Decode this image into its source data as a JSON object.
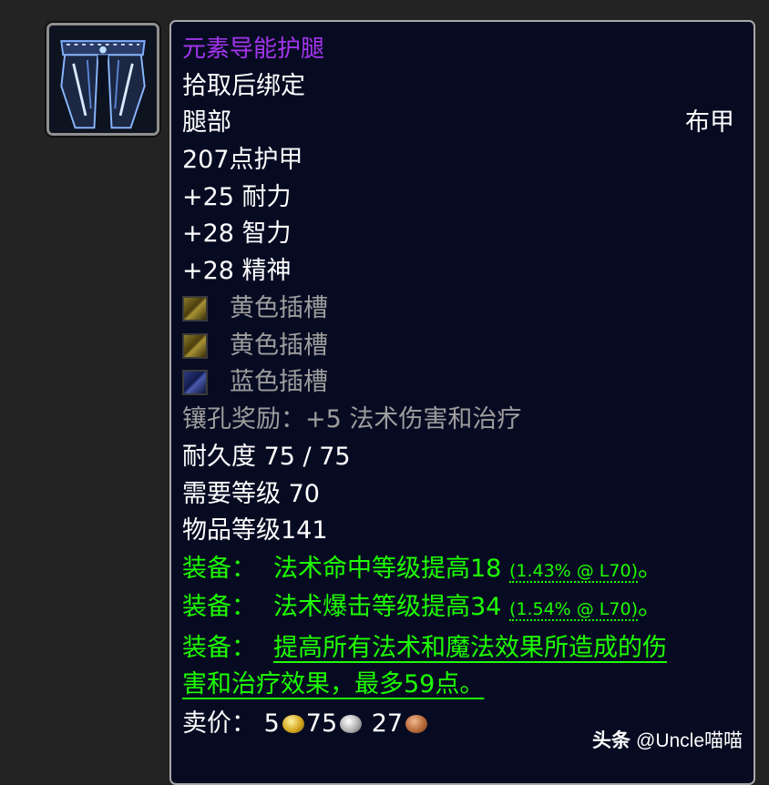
{
  "item": {
    "icon": "cloth-leggings-icon",
    "name": "元素导能护腿",
    "binding": "拾取后绑定",
    "slot": "腿部",
    "armor_type": "布甲",
    "armor": "207点护甲",
    "stats": [
      "+25 耐力",
      "+28 智力",
      "+28 精神"
    ],
    "sockets": [
      {
        "label": "黄色插槽",
        "color": "yellow",
        "icon": "yellow-socket-icon"
      },
      {
        "label": "黄色插槽",
        "color": "yellow",
        "icon": "yellow-socket-icon"
      },
      {
        "label": "蓝色插槽",
        "color": "blue",
        "icon": "blue-socket-icon"
      }
    ],
    "socket_bonus": "镶孔奖励：+5 法术伤害和治疗",
    "durability": "耐久度 75 / 75",
    "required_level": "需要等级 70",
    "item_level": "物品等级141",
    "equip_effects": [
      {
        "prefix": "装备：",
        "text": "法术命中等级提高18",
        "pct": "(1.43% @ L70)",
        "suffix": "。"
      },
      {
        "prefix": "装备：",
        "text": "法术爆击等级提高34",
        "pct": "(1.54% @ L70)",
        "suffix": "。"
      },
      {
        "prefix": "装备：",
        "text_line1": "提高所有法术和魔法效果所造成的伤",
        "text_line2": "害和治疗效果，最多59点。"
      }
    ],
    "sell_price": {
      "label": "卖价：",
      "gold": "5",
      "silver": "75",
      "copper": "27"
    }
  },
  "watermark": {
    "brand": "头条",
    "handle": "@Uncle喵喵"
  },
  "colors": {
    "epic_purple": "#a335ee",
    "equip_green": "#1eff00",
    "gray_text": "#9d9d9d",
    "tooltip_bg": "#070b22",
    "page_bg": "#232323"
  }
}
